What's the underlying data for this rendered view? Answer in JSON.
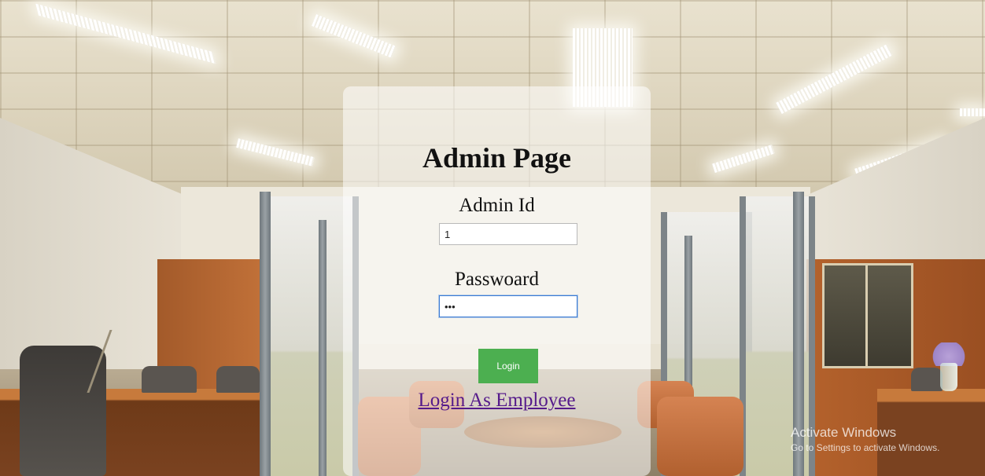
{
  "background": {
    "description_icon": "office-interior-background"
  },
  "login_panel": {
    "title": "Admin Page",
    "admin_id": {
      "label": "Admin Id",
      "value": "1"
    },
    "password": {
      "label": "Passwoard",
      "value": "•••"
    },
    "login_button": {
      "label": "Login",
      "color": "#4caf50"
    },
    "employee_link": {
      "label": "Login As Employee",
      "color": "#551a8b"
    }
  },
  "os_watermark": {
    "title": "Activate Windows",
    "subtitle": "Go to Settings to activate Windows."
  }
}
